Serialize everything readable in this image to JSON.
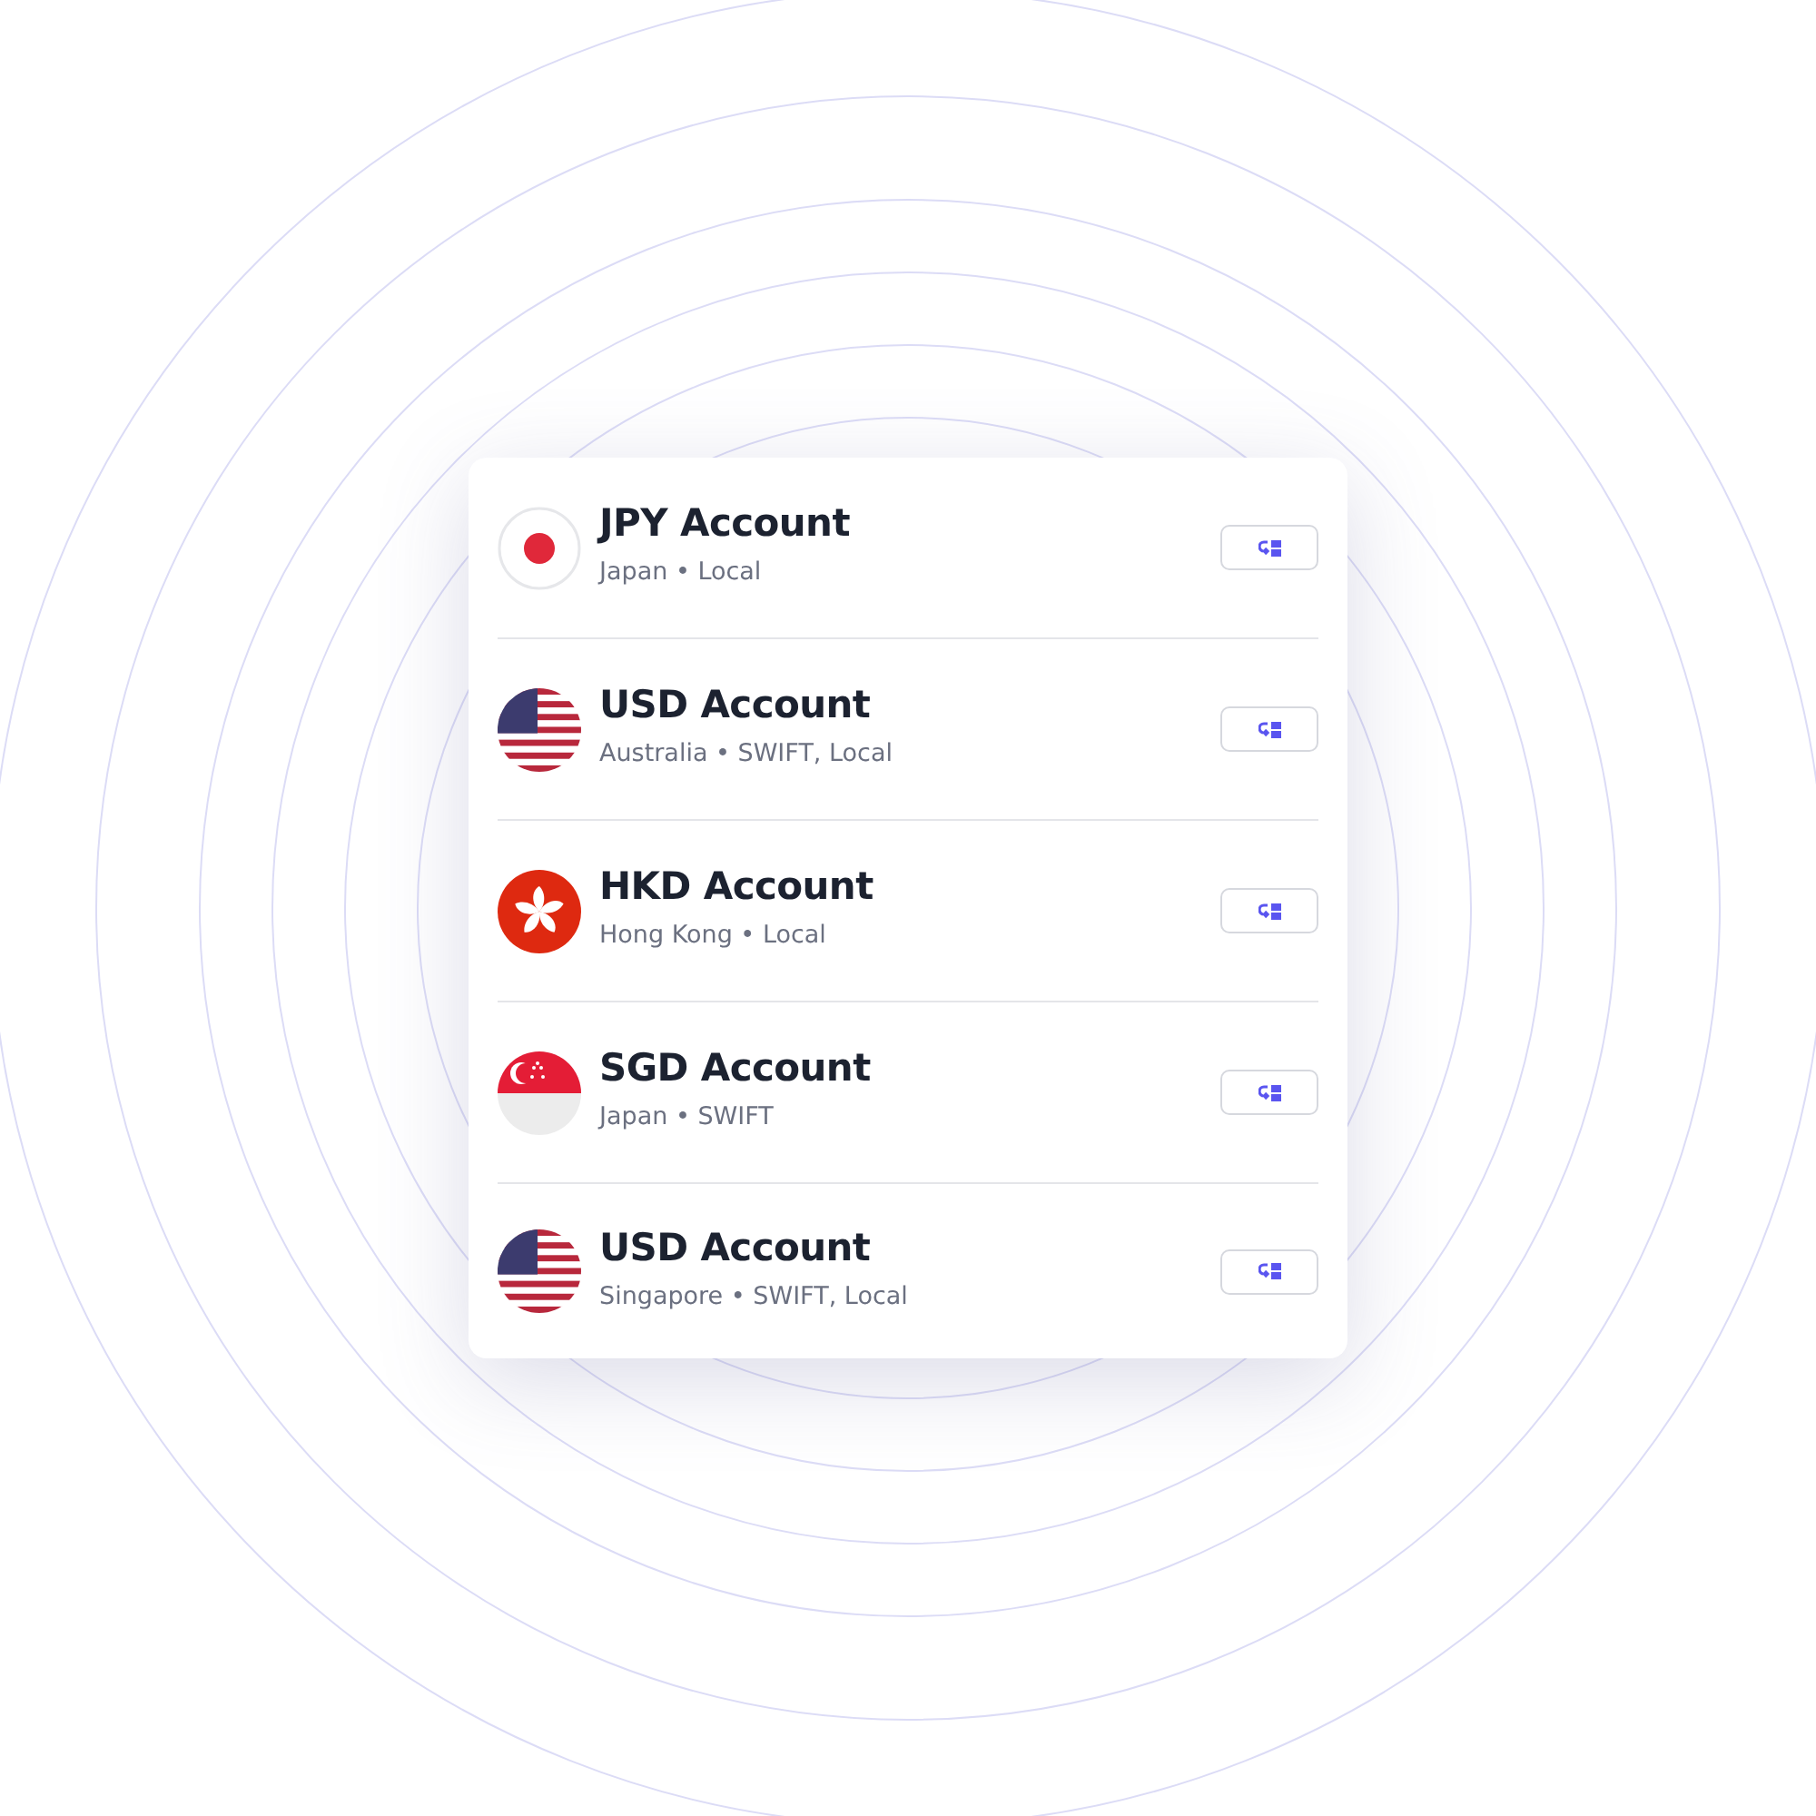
{
  "accounts": [
    {
      "title": "JPY Account",
      "subtitle": "Japan • Local",
      "kind": "jp"
    },
    {
      "title": "USD Account",
      "subtitle": "Australia • SWIFT, Local",
      "kind": "us"
    },
    {
      "title": "HKD Account",
      "subtitle": "Hong Kong • Local",
      "kind": "hk"
    },
    {
      "title": "SGD Account",
      "subtitle": "Japan • SWIFT",
      "kind": "sg"
    },
    {
      "title": "USD Account",
      "subtitle": "Singapore • SWIFT, Local",
      "kind": "us"
    }
  ]
}
